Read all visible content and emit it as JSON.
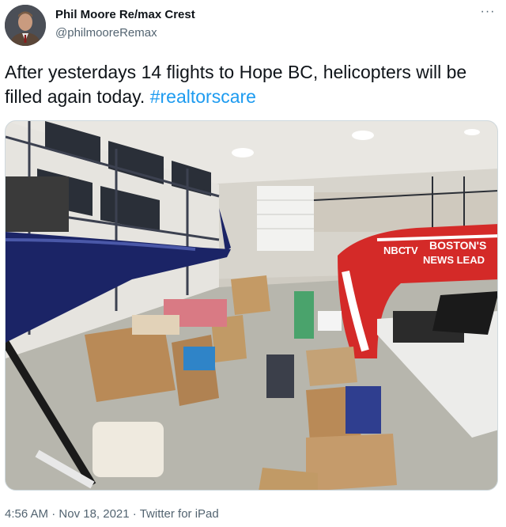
{
  "user": {
    "display_name": "Phil Moore Re/max Crest",
    "handle": "@philmooreRemax",
    "avatar_icon": "profile-photo"
  },
  "tweet": {
    "text_before": "After yesterdays 14 flights to Hope BC, helicopters will be filled again today. ",
    "hashtag": "#realtorscare",
    "more_label": "···"
  },
  "media": {
    "helicopter_logo_line1": "BOSTON'S",
    "helicopter_logo_line2": "NEWS LEAD",
    "helicopter_logo_prefix": "NBC",
    "helicopter_logo_suffix": "TV"
  },
  "meta": {
    "time": "4:56 AM",
    "date": "Nov 18, 2021",
    "source": "Twitter for iPad",
    "separator": " · "
  },
  "colors": {
    "link": "#1d9bf0",
    "secondary_text": "#536471",
    "helicopter_red": "#d42a28",
    "helicopter_blue": "#1b2466"
  }
}
